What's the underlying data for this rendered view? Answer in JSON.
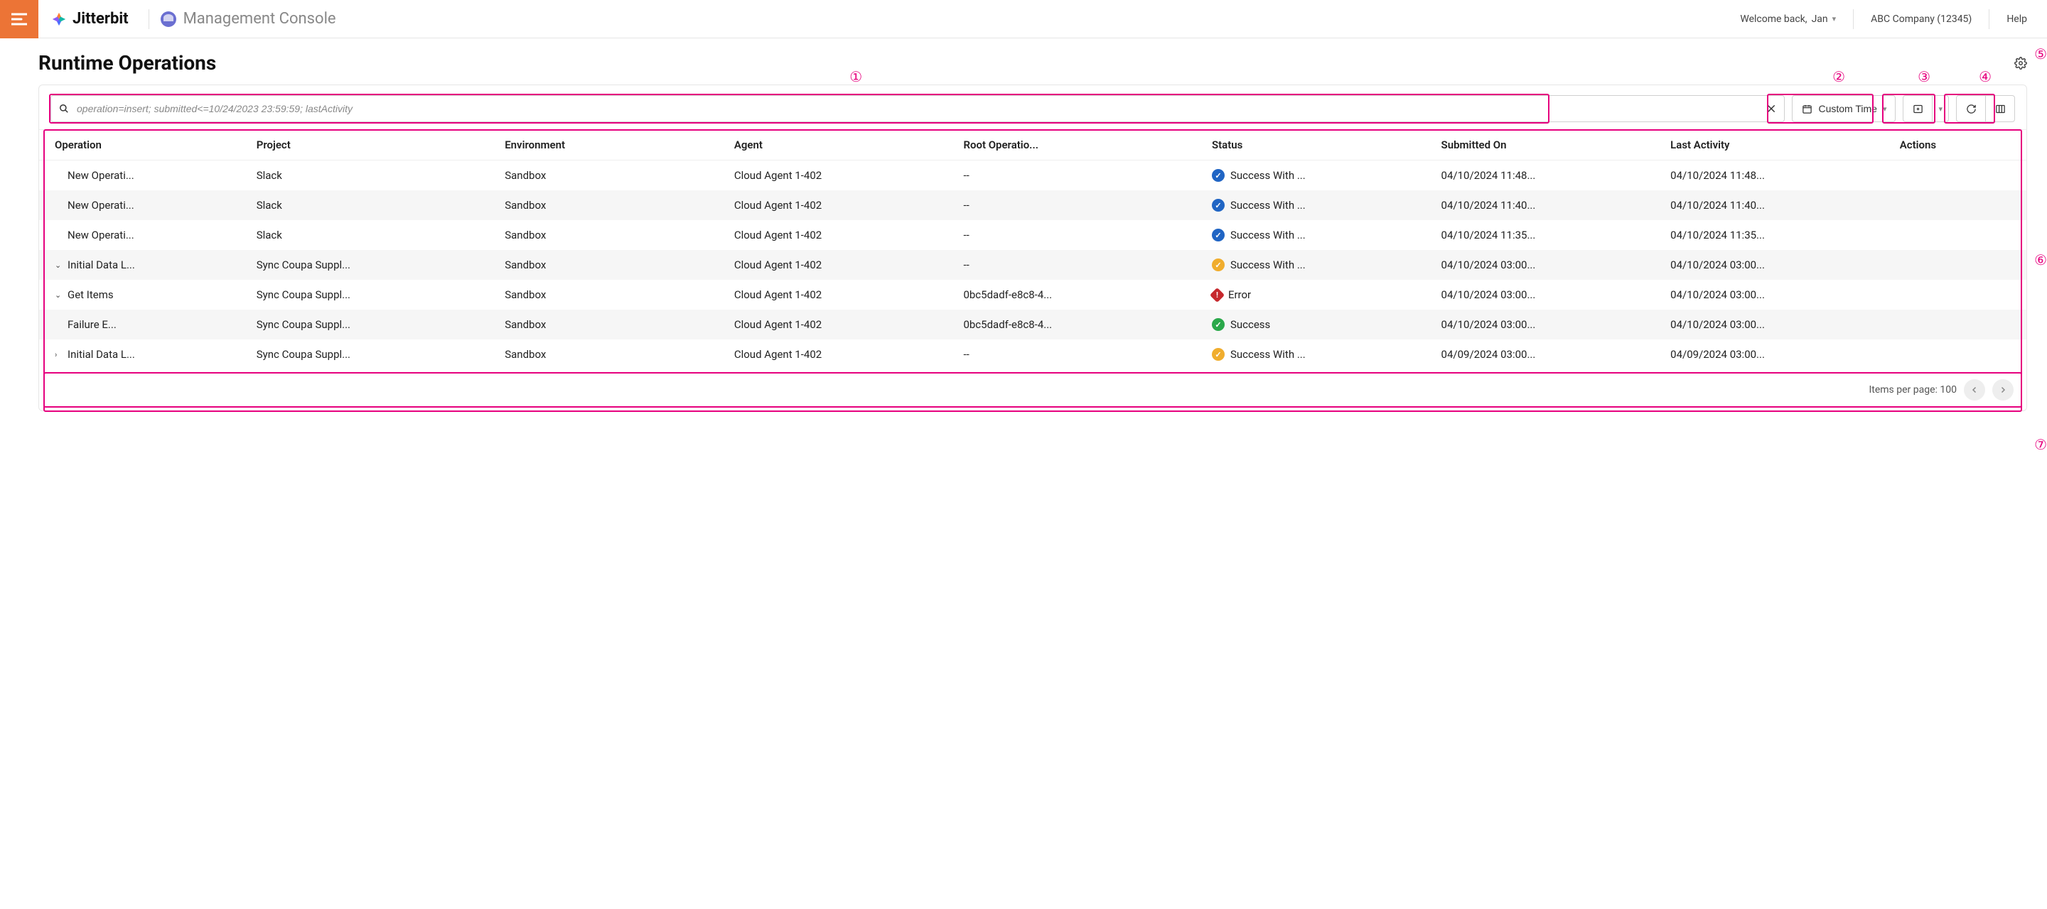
{
  "header": {
    "brand": "Jitterbit",
    "console_label": "Management Console",
    "welcome_prefix": "Welcome back, ",
    "user_name": "Jan",
    "org_label": "ABC Company (12345)",
    "help_label": "Help"
  },
  "page": {
    "title": "Runtime Operations"
  },
  "search": {
    "placeholder": "operation=insert; submitted<=10/24/2023 23:59:59; lastActivity"
  },
  "time_filter": {
    "label": "Custom Time"
  },
  "columns": {
    "operation": "Operation",
    "project": "Project",
    "environment": "Environment",
    "agent": "Agent",
    "root": "Root Operatio...",
    "status": "Status",
    "submitted": "Submitted On",
    "last": "Last Activity",
    "actions": "Actions"
  },
  "rows": [
    {
      "caret": "",
      "indent": 0,
      "operation": "New Operati...",
      "project": "Slack",
      "environment": "Sandbox",
      "agent": "Cloud Agent 1-402",
      "root": "--",
      "status_kind": "blue",
      "status": "Success With ...",
      "submitted": "04/10/2024 11:48...",
      "last": "04/10/2024 11:48..."
    },
    {
      "caret": "",
      "indent": 0,
      "operation": "New Operati...",
      "project": "Slack",
      "environment": "Sandbox",
      "agent": "Cloud Agent 1-402",
      "root": "--",
      "status_kind": "blue",
      "status": "Success With ...",
      "submitted": "04/10/2024 11:40...",
      "last": "04/10/2024 11:40..."
    },
    {
      "caret": "",
      "indent": 0,
      "operation": "New Operati...",
      "project": "Slack",
      "environment": "Sandbox",
      "agent": "Cloud Agent 1-402",
      "root": "--",
      "status_kind": "blue",
      "status": "Success With ...",
      "submitted": "04/10/2024 11:35...",
      "last": "04/10/2024 11:35..."
    },
    {
      "caret": "v",
      "indent": 0,
      "operation": "Initial Data L...",
      "project": "Sync Coupa Suppl...",
      "environment": "Sandbox",
      "agent": "Cloud Agent 1-402",
      "root": "--",
      "status_kind": "orange",
      "status": "Success With ...",
      "submitted": "04/10/2024 03:00...",
      "last": "04/10/2024 03:00..."
    },
    {
      "caret": "v",
      "indent": 1,
      "operation": "Get Items",
      "project": "Sync Coupa Suppl...",
      "environment": "Sandbox",
      "agent": "Cloud Agent 1-402",
      "root": "0bc5dadf-e8c8-4...",
      "status_kind": "red",
      "status": "Error",
      "submitted": "04/10/2024 03:00...",
      "last": "04/10/2024 03:00..."
    },
    {
      "caret": "",
      "indent": 2,
      "operation": "Failure E...",
      "project": "Sync Coupa Suppl...",
      "environment": "Sandbox",
      "agent": "Cloud Agent 1-402",
      "root": "0bc5dadf-e8c8-4...",
      "status_kind": "green",
      "status": "Success",
      "submitted": "04/10/2024 03:00...",
      "last": "04/10/2024 03:00..."
    },
    {
      "caret": ">",
      "indent": 0,
      "operation": "Initial Data L...",
      "project": "Sync Coupa Suppl...",
      "environment": "Sandbox",
      "agent": "Cloud Agent 1-402",
      "root": "--",
      "status_kind": "orange",
      "status": "Success With ...",
      "submitted": "04/09/2024 03:00...",
      "last": "04/09/2024 03:00..."
    }
  ],
  "pager": {
    "label": "Items per page: 100"
  },
  "annotations": {
    "n1": "①",
    "n2": "②",
    "n3": "③",
    "n4": "④",
    "n5": "⑤",
    "n6": "⑥",
    "n7": "⑦"
  }
}
